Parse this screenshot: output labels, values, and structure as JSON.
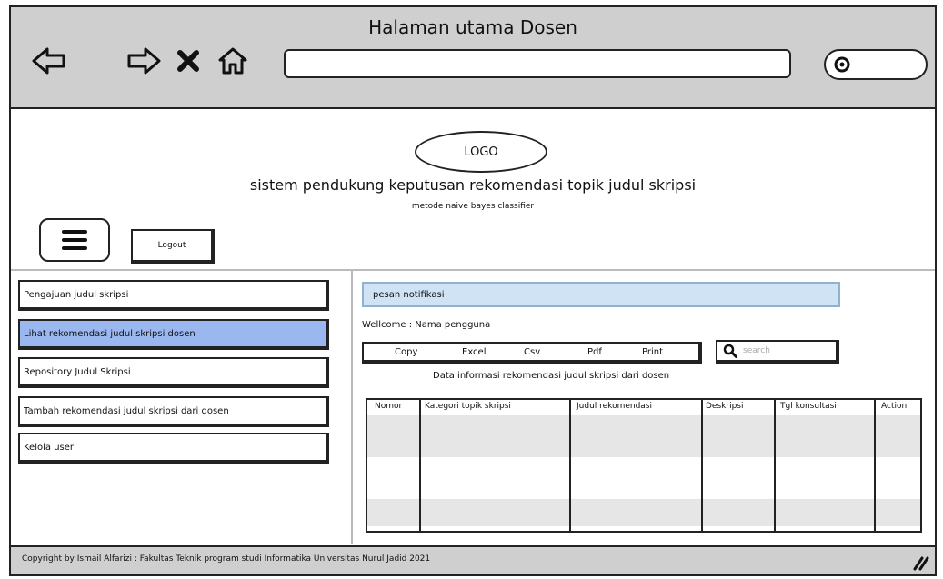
{
  "window": {
    "title": "Halaman utama Dosen",
    "url_value": "",
    "toolbar_icons": [
      "back-arrow-icon",
      "forward-arrow-icon",
      "close-x-icon",
      "home-icon"
    ]
  },
  "header": {
    "logo_text": "LOGO",
    "title": "sistem pendukung keputusan rekomendasi topik judul skripsi",
    "subtitle": "metode naive bayes classifier",
    "logout_label": "Logout"
  },
  "sidebar": {
    "items": [
      {
        "label": "Pengajuan judul skripsi",
        "active": false
      },
      {
        "label": "Lihat rekomendasi judul skripsi dosen",
        "active": true
      },
      {
        "label": "Repository Judul Skripsi",
        "active": false
      },
      {
        "label": "Tambah rekomendasi judul skripsi dari dosen",
        "active": false
      },
      {
        "label": "Kelola user",
        "active": false
      }
    ]
  },
  "main": {
    "notification": "pesan notifikasi",
    "welcome": "Wellcome : Nama pengguna",
    "export_buttons": [
      "Copy",
      "Excel",
      "Csv",
      "Pdf",
      "Print"
    ],
    "search_placeholder": "search",
    "table_caption": "Data informasi rekomendasi judul skripsi dari dosen",
    "table": {
      "columns": [
        "Nomor",
        "Kategori topik skripsi",
        "Judul rekomendasi",
        "Deskripsi",
        "Tgl konsultasi",
        "Action"
      ],
      "rows": []
    }
  },
  "footer": {
    "text": "Copyright by Ismail Alfarizi : Fakultas Teknik program studi Informatika Universitas Nurul Jadid 2021"
  },
  "colors": {
    "chrome": "#cfcfcf",
    "active_item": "#9ab8ef",
    "notification_bg": "#cfe3f5",
    "table_band": "#e6e6e6"
  }
}
